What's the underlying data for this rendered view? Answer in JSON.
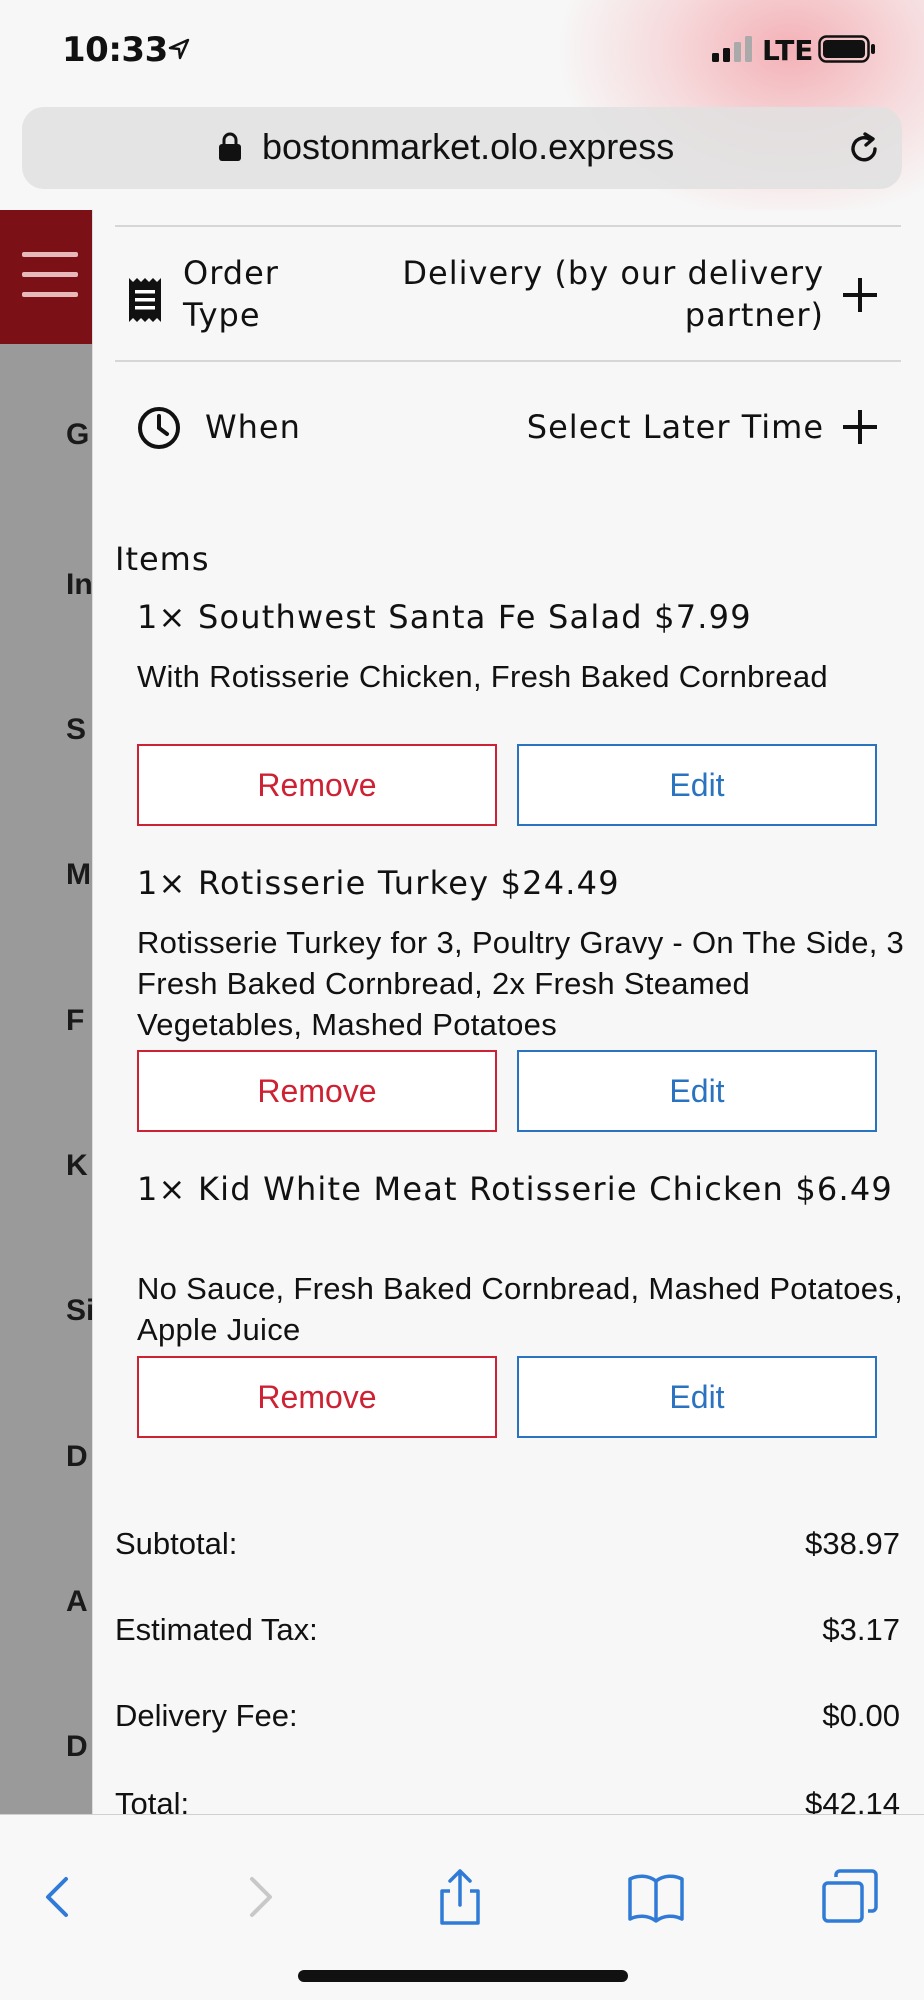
{
  "status_bar": {
    "time": "10:33",
    "network": "LTE"
  },
  "browser": {
    "url": "bostonmarket.olo.express"
  },
  "background_menu": {
    "letters": [
      "G",
      "In",
      "S",
      "M",
      "F",
      "K",
      "Si",
      "D",
      "A",
      "D"
    ]
  },
  "order_type": {
    "label_line1": "Order",
    "label_line2": "Type",
    "value_line1": "Delivery (by our delivery",
    "value_line2": "partner)"
  },
  "when": {
    "label": "When",
    "value": "Select Later Time"
  },
  "items": {
    "heading": "Items",
    "list": [
      {
        "title": "1× Southwest Santa Fe Salad $7.99",
        "description": "With Rotisserie Chicken, Fresh Baked Cornbread",
        "remove_label": "Remove",
        "edit_label": "Edit"
      },
      {
        "title": "1× Rotisserie Turkey $24.49",
        "description": "Rotisserie Turkey for 3, Poultry Gravy - On The Side, 3 Fresh Baked Cornbread, 2x Fresh Steamed Vegetables, Mashed Potatoes",
        "remove_label": "Remove",
        "edit_label": "Edit"
      },
      {
        "title": "1× Kid White Meat Rotisserie Chicken $6.49",
        "description": "No Sauce, Fresh Baked Cornbread, Mashed Potatoes, Apple Juice",
        "remove_label": "Remove",
        "edit_label": "Edit"
      }
    ]
  },
  "summary": {
    "subtotal_label": "Subtotal:",
    "subtotal_value": "$38.97",
    "tax_label": "Estimated Tax:",
    "tax_value": "$3.17",
    "delivery_label": "Delivery Fee:",
    "delivery_value": "$0.00",
    "total_label": "Total:",
    "total_value": "$42.14"
  },
  "colors": {
    "brand_red": "#7b1017",
    "remove_red": "#cc2233",
    "edit_blue": "#2a73c0",
    "ios_blue": "#2f7bd6"
  }
}
